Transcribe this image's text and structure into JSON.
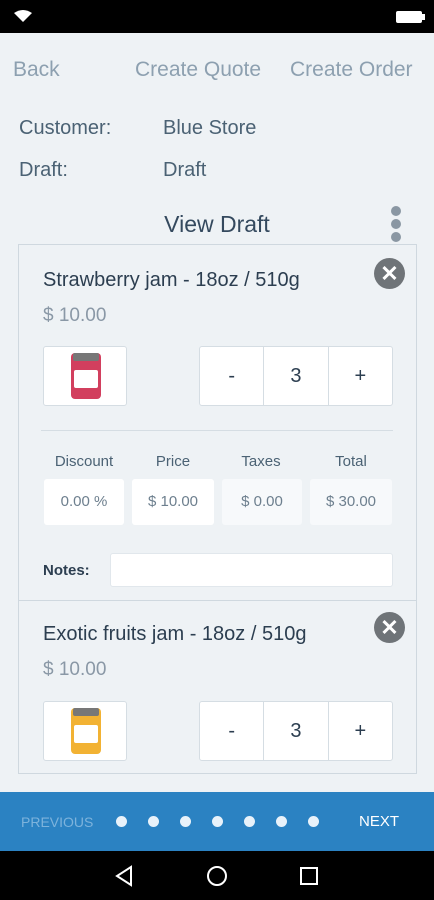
{
  "topnav": {
    "back": "Back",
    "create_quote": "Create Quote",
    "create_order": "Create Order"
  },
  "meta": {
    "customer_label": "Customer:",
    "customer_value": "Blue Store",
    "draft_label": "Draft:",
    "draft_value": "Draft"
  },
  "view_draft": "View Draft",
  "columns": {
    "discount": "Discount",
    "price": "Price",
    "taxes": "Taxes",
    "total": "Total"
  },
  "items": [
    {
      "title": "Strawberry jam - 18oz / 510g",
      "price": "$ 10.00",
      "minus": "-",
      "qty": "3",
      "plus": "+",
      "discount": "0.00 %",
      "unit_price": "$ 10.00",
      "taxes": "$ 0.00",
      "total": "$ 30.00",
      "notes_label": "Notes:",
      "jar_color": "#d23f5e",
      "icon": "strawberry-jam-image"
    },
    {
      "title": "Exotic fruits jam - 18oz / 510g",
      "price": "$ 10.00",
      "minus": "-",
      "qty": "3",
      "plus": "+",
      "jar_color": "#f2b233",
      "icon": "exotic-jam-image"
    }
  ],
  "close_glyph": "✕",
  "pager": {
    "previous": "PREVIOUS",
    "next": "NEXT",
    "active_page": 1,
    "total_pages": 7
  },
  "colors": {
    "accent": "#2b82c2",
    "background": "#eef2f5"
  }
}
